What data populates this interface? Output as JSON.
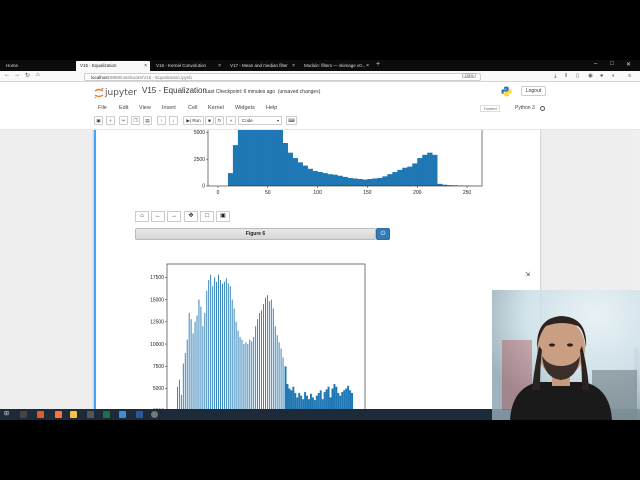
{
  "browser": {
    "tabs": [
      {
        "label": "Home",
        "active": false
      },
      {
        "label": "V15 - Equalization",
        "active": true
      },
      {
        "label": "V16 - Kernel Convolution",
        "active": false
      },
      {
        "label": "V17 - Mean and median filter",
        "active": false
      },
      {
        "label": "Module: filters — skimage v0...",
        "active": false
      }
    ],
    "url_prefix": "localhost",
    "url_rest": ":8888/notebooks/V15 - Equalization.ipynb",
    "zoom": "133%"
  },
  "jupyter": {
    "logo_text": "jupyter",
    "notebook_title": "V15 - Equalization",
    "checkpoint": "Last Checkpoint: 6 minutes ago",
    "unsaved": "(unsaved changes)",
    "logout": "Logout",
    "menu": [
      "File",
      "Edit",
      "View",
      "Insert",
      "Cell",
      "Kernel",
      "Widgets",
      "Help"
    ],
    "trusted": "Trusted",
    "kernel": "Python 3",
    "toolbar": {
      "run": "Run",
      "cell_type": "Code"
    }
  },
  "figure_header": "Figure 6",
  "chart_data": [
    {
      "type": "bar",
      "description_axes": {
        "x_ticks": [
          "0",
          "50",
          "100",
          "150",
          "200",
          "250"
        ],
        "y_ticks": [
          "0",
          "2500",
          "5000"
        ],
        "xlim": [
          -10,
          265
        ]
      },
      "x": [
        0,
        5,
        10,
        15,
        20,
        25,
        30,
        35,
        40,
        45,
        50,
        55,
        60,
        65,
        70,
        75,
        80,
        85,
        90,
        95,
        100,
        105,
        110,
        115,
        120,
        125,
        130,
        135,
        140,
        145,
        150,
        155,
        160,
        165,
        170,
        175,
        180,
        185,
        190,
        195,
        200,
        205,
        210,
        215,
        220,
        225,
        230,
        235,
        240,
        245,
        250,
        255
      ],
      "values": [
        0,
        0,
        1200,
        3800,
        6500,
        7000,
        7200,
        7500,
        7400,
        7300,
        7200,
        7000,
        6000,
        4000,
        3100,
        2600,
        2200,
        1900,
        1600,
        1400,
        1300,
        1200,
        1100,
        1050,
        950,
        850,
        750,
        700,
        650,
        600,
        650,
        700,
        750,
        900,
        1100,
        1300,
        1500,
        1700,
        1800,
        2100,
        2600,
        2900,
        3100,
        2900,
        200,
        120,
        80,
        60,
        40,
        30,
        20,
        10
      ],
      "ylim": [
        0,
        8000
      ]
    },
    {
      "type": "bar",
      "description_axes": {
        "y_ticks": [
          "2500",
          "5000",
          "7500",
          "10000",
          "12500",
          "15000",
          "17500"
        ]
      },
      "x": [
        0,
        1,
        2,
        3,
        4,
        5,
        6,
        7,
        8,
        9,
        10,
        11,
        12,
        13,
        14,
        15,
        16,
        17,
        18,
        19,
        20,
        21,
        22,
        23,
        24,
        25,
        26,
        27,
        28,
        29,
        30,
        31,
        32,
        33,
        34,
        35,
        36,
        37,
        38,
        39,
        40,
        41,
        42,
        43,
        44,
        45,
        46,
        47,
        48,
        49,
        50,
        51,
        52,
        53,
        54,
        55,
        56,
        57,
        58,
        59,
        60,
        61,
        62,
        63,
        64,
        65,
        66,
        67,
        68,
        69,
        70,
        71,
        72,
        73,
        74,
        75,
        76,
        77,
        78,
        79,
        80,
        81,
        82,
        83,
        84,
        85,
        86,
        87,
        88,
        89
      ],
      "values": [
        5200,
        6000,
        4300,
        7800,
        9000,
        10500,
        13500,
        12800,
        11200,
        12500,
        13200,
        15000,
        14200,
        12000,
        13500,
        16000,
        17200,
        17800,
        16500,
        17500,
        17000,
        17800,
        17200,
        16800,
        17000,
        17400,
        16800,
        16500,
        15000,
        14000,
        12500,
        11500,
        10800,
        10500,
        10000,
        10200,
        10000,
        10500,
        10300,
        10800,
        12000,
        12800,
        13500,
        13800,
        14500,
        15200,
        15500,
        14800,
        15000,
        14000,
        12000,
        11000,
        10200,
        9500,
        8500,
        7500,
        5500,
        5000,
        4800,
        5200,
        4500,
        4000,
        4500,
        4200,
        3800,
        4600,
        4200,
        3800,
        4400,
        4000,
        3700,
        4200,
        4500,
        4800,
        3800,
        4600,
        4900,
        5200,
        4000,
        5000,
        5500,
        5200,
        4500,
        4200,
        4600,
        4800,
        5000,
        5300,
        4800,
        4500
      ],
      "ylim": [
        0,
        19000
      ]
    }
  ],
  "taskbar": {
    "time": ""
  }
}
